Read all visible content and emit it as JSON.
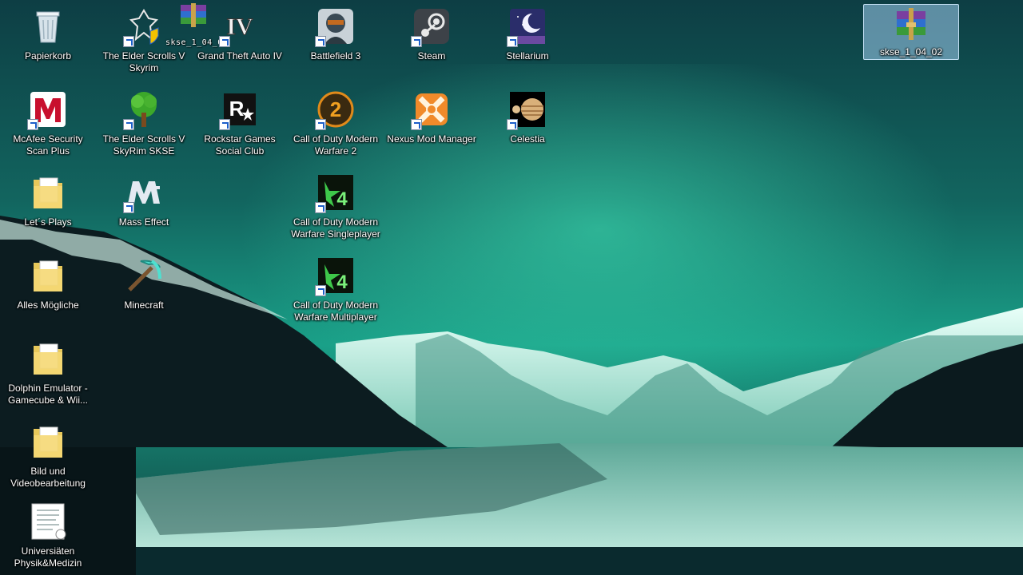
{
  "desktop": {
    "icons": [
      {
        "label": "Papierkorb",
        "icon": "recycle-bin-icon"
      },
      {
        "label": "The Elder Scrolls V Skyrim",
        "icon": "skyrim-icon"
      },
      {
        "label": "Grand Theft Auto IV",
        "icon": "gta4-icon"
      },
      {
        "label": "Battlefield 3",
        "icon": "battlefield-icon"
      },
      {
        "label": "Steam",
        "icon": "steam-icon"
      },
      {
        "label": "Stellarium",
        "icon": "stellarium-icon"
      },
      {
        "label": "skse_1_04_02",
        "icon": "winrar-archive-icon"
      },
      {
        "label": "McAfee Security Scan Plus",
        "icon": "mcafee-icon"
      },
      {
        "label": "The Elder Scrolls V SkyRim SKSE",
        "icon": "tree-icon"
      },
      {
        "label": "Rockstar Games Social Club",
        "icon": "rockstar-icon"
      },
      {
        "label": "Call of Duty Modern Warfare 2",
        "icon": "cod-mw2-icon"
      },
      {
        "label": "Nexus Mod Manager",
        "icon": "nexus-icon"
      },
      {
        "label": "Celestia",
        "icon": "celestia-icon"
      },
      {
        "label": "Let´s Plays",
        "icon": "folder-icon"
      },
      {
        "label": "Mass Effect",
        "icon": "mass-effect-icon"
      },
      {
        "label": "Call of Duty Modern Warfare Singleplayer",
        "icon": "cod4-icon"
      },
      {
        "label": "Alles Mögliche",
        "icon": "folder-icon"
      },
      {
        "label": "Minecraft",
        "icon": "pickaxe-icon"
      },
      {
        "label": "Call of Duty Modern Warfare Multiplayer",
        "icon": "cod4-icon"
      },
      {
        "label": "Dolphin Emulator - Gamecube & Wii...",
        "icon": "folder-icon"
      },
      {
        "label": "Bild und Videobearbeitung",
        "icon": "folder-icon"
      },
      {
        "label": "Universiäten Physik&Medizin",
        "icon": "document-icon"
      }
    ],
    "drag_ghost_label": "skse_1_04_02"
  },
  "colors": {
    "sky_top": "#0f4a4a",
    "sky_mid": "#1a8c7a",
    "glow": "#40e0b0",
    "mountain_dark": "#0c1a1e",
    "snow": "#d8f5ee",
    "water": "#0a2a2e"
  }
}
